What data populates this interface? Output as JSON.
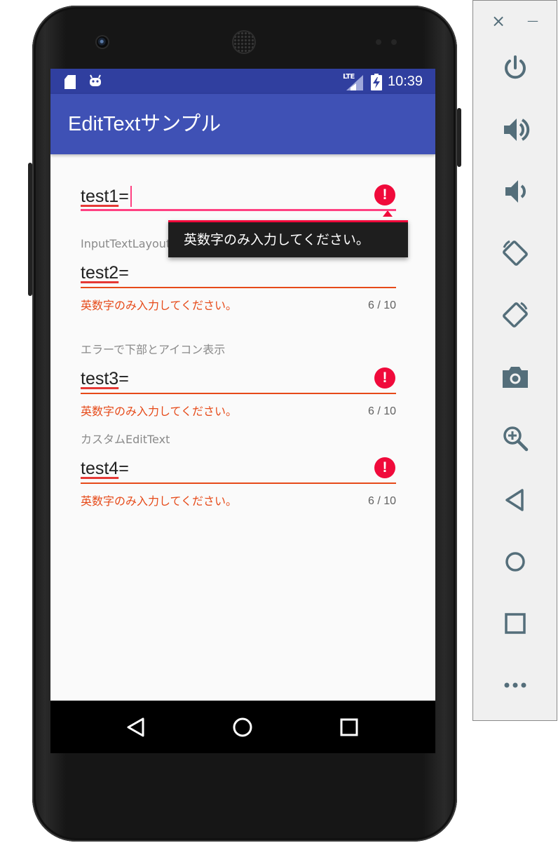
{
  "status_bar": {
    "network_label": "LTE",
    "time": "10:39",
    "icons": [
      "sd-card-icon",
      "android-robot-icon",
      "cell-signal-icon",
      "battery-charging-icon"
    ]
  },
  "toolbar": {
    "title": "EditTextサンプル"
  },
  "fields": [
    {
      "value_word": "test1",
      "value_suffix": "=",
      "focused": true,
      "show_error_icon": true,
      "error_popup": "英数字のみ入力してください。"
    },
    {
      "label": "InputTextLayout",
      "value_word": "test2",
      "value_suffix": "=",
      "error": "英数字のみ入力してください。",
      "counter": "6 / 10"
    },
    {
      "label": "エラーで下部とアイコン表示",
      "value_word": "test3",
      "value_suffix": "=",
      "show_error_icon": true,
      "error": "英数字のみ入力してください。",
      "counter": "6 / 10"
    },
    {
      "label": "カスタムEditText",
      "value_word": "test4",
      "value_suffix": "=",
      "show_error_icon": true,
      "error": "英数字のみ入力してください。",
      "counter": "6 / 10"
    }
  ],
  "nav_bar": {
    "buttons": [
      "back-icon",
      "home-icon",
      "recents-icon"
    ]
  },
  "emulator_panel": {
    "close_glyph": "×",
    "minimize_glyph": "—",
    "buttons": [
      "power-icon",
      "volume-up-icon",
      "volume-down-icon",
      "rotate-left-icon",
      "rotate-right-icon",
      "camera-icon",
      "zoom-icon",
      "back-icon",
      "home-icon",
      "overview-icon",
      "more-icon"
    ]
  },
  "colors": {
    "status_bar": "#303f9f",
    "toolbar": "#3f51b5",
    "accent": "#ff4081",
    "error": "#e64a19",
    "error_icon": "#f00a3b",
    "panel_icon": "#546e7a"
  }
}
